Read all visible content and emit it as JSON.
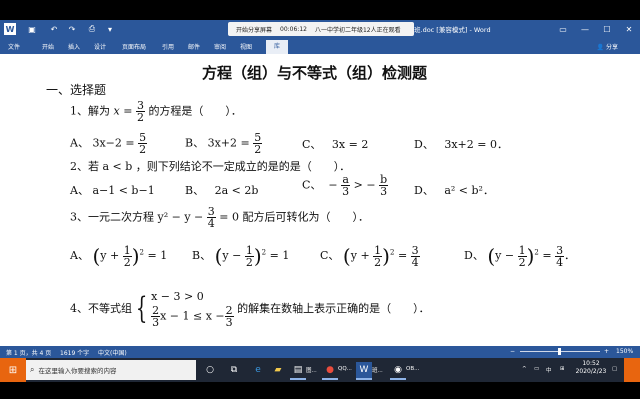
{
  "titlebar": {
    "recording_strip": {
      "left_text": "开始分享屏幕",
      "timer": "00:06:12",
      "right_text": "八一中学初二年级12人正在观看"
    },
    "doc_title": "班.doc [兼容模式] - Word",
    "quick_access": [
      "word-logo-icon",
      "save-icon",
      "undo-icon",
      "redo-icon",
      "print-icon",
      "dropdown-icon"
    ]
  },
  "ribbon": {
    "tabs": [
      "文件",
      "开始",
      "插入",
      "设计",
      "页面布局",
      "引用",
      "邮件",
      "审阅",
      "视图",
      "库"
    ],
    "active_tab": "库",
    "share": "分享"
  },
  "document": {
    "heading": "方程（组）与不等式（组）检测题",
    "section": "一、选择题",
    "q1": {
      "prefix": "1、解为",
      "var": "x",
      "num": "3",
      "den": "2",
      "suffix": "的方程是（　　）．"
    },
    "q1_options": {
      "A": {
        "label": "A、",
        "pre": "3x−2 =",
        "num": "5",
        "den": "2"
      },
      "B": {
        "label": "B、",
        "pre": "3x+2 =",
        "num": "5",
        "den": "2"
      },
      "C": {
        "label": "C、",
        "expr": "3x = 2"
      },
      "D": {
        "label": "D、",
        "expr": "3x+2 = 0．"
      }
    },
    "q2": {
      "text": "2、若 a < b ，则下列结论不一定成立的是的是（　　）．"
    },
    "q2_options": {
      "A": {
        "label": "A、",
        "expr": "a−1 < b−1"
      },
      "B": {
        "label": "B、",
        "expr": "2a < 2b"
      },
      "C": {
        "label": "C、",
        "pre": "−",
        "num1": "a",
        "den1": "3",
        "mid": "> −",
        "num2": "b",
        "den2": "3"
      },
      "D": {
        "label": "D、",
        "expr": "a² < b²．"
      }
    },
    "q3": {
      "pre": "3、一元二次方程 y² − y −",
      "num": "3",
      "den": "4",
      "suffix": "= 0 配方后可转化为（　　）．"
    },
    "q3_options": {
      "A": {
        "label": "A、",
        "inner": "y +",
        "num": "1",
        "den": "2",
        "rhs": "= 1"
      },
      "B": {
        "label": "B、",
        "inner": "y −",
        "num": "1",
        "den": "2",
        "rhs": "= 1"
      },
      "C": {
        "label": "C、",
        "inner": "y +",
        "num": "1",
        "den": "2",
        "rhs_num": "3",
        "rhs_den": "4"
      },
      "D": {
        "label": "D、",
        "inner": "y −",
        "num": "1",
        "den": "2",
        "rhs_num": "3",
        "rhs_den": "4",
        "tail": "．"
      }
    },
    "q4": {
      "prefix": "4、不等式组",
      "line1": "x − 3 > 0",
      "line2_num": "2",
      "line2_den": "3",
      "line2_mid": "x − 1 ≤ x −",
      "line2_num2": "2",
      "line2_den2": "3",
      "suffix": "的解集在数轴上表示正确的是（　　）．"
    }
  },
  "statusbar": {
    "page": "第 1 页，共 4 页",
    "words": "1619 个字",
    "lang": "中文(中国)",
    "zoom": "150%"
  },
  "taskbar": {
    "search_placeholder": "在这里输入你要搜索的内容",
    "apps": [
      {
        "icon": "cortana-icon",
        "label": ""
      },
      {
        "icon": "task-view-icon",
        "label": ""
      },
      {
        "icon": "edge-icon",
        "label": ""
      },
      {
        "icon": "explorer-icon",
        "label": ""
      },
      {
        "icon": "media-icon",
        "label": "图..."
      },
      {
        "icon": "qq-icon",
        "label": "QQ..."
      },
      {
        "icon": "word-icon",
        "label": "班..."
      },
      {
        "icon": "obs-icon",
        "label": "OB..."
      }
    ],
    "tray_ime": "中",
    "time": "10:52",
    "date": "2020/2/23"
  }
}
